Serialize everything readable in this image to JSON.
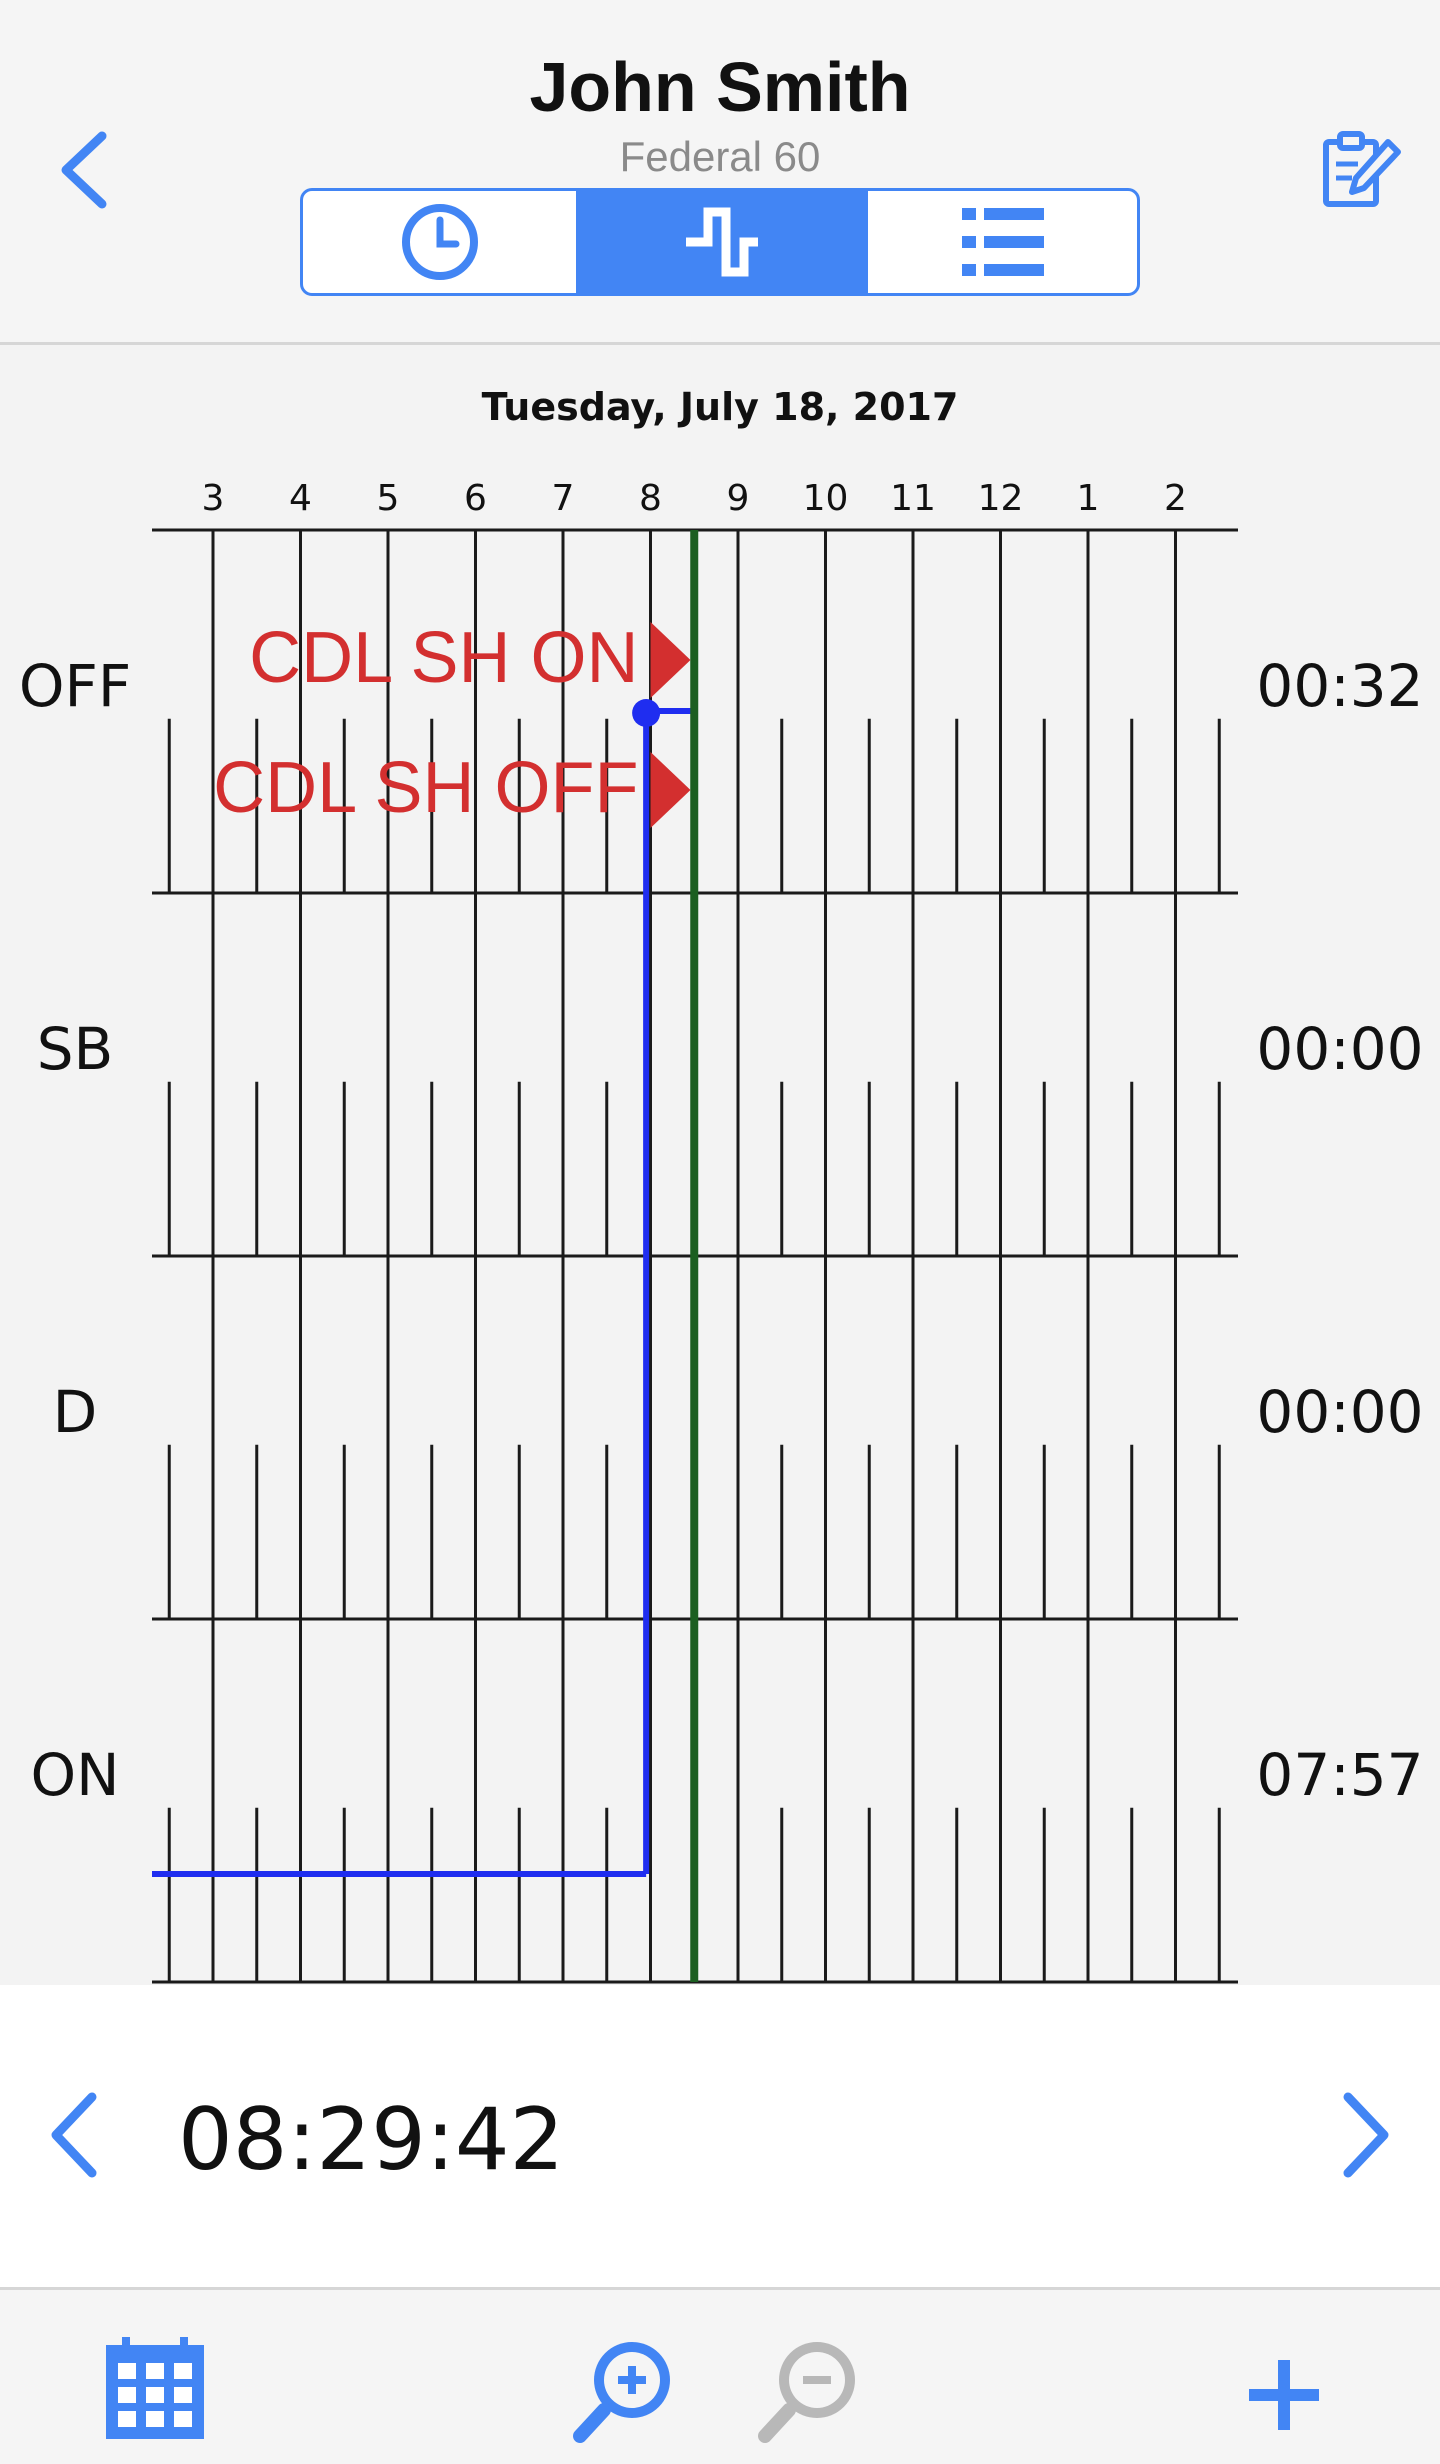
{
  "header": {
    "driver_name": "John Smith",
    "rule_set": "Federal 60",
    "tabs": [
      {
        "icon": "clock-icon",
        "selected": false
      },
      {
        "icon": "graph-icon",
        "selected": true
      },
      {
        "icon": "list-icon",
        "selected": false
      }
    ],
    "back_icon": "chevron-left-icon",
    "edit_icon": "edit-log-icon"
  },
  "graph": {
    "date": "Tuesday, July 18, 2017",
    "hour_labels": [
      "3",
      "4",
      "5",
      "6",
      "7",
      "8",
      "9",
      "10",
      "11",
      "12",
      "1",
      "2"
    ],
    "rows": [
      {
        "status": "OFF",
        "total": "00:32"
      },
      {
        "status": "SB",
        "total": "00:00"
      },
      {
        "status": "D",
        "total": "00:00"
      },
      {
        "status": "ON",
        "total": "07:57"
      }
    ],
    "events": [
      {
        "label": "CDL SH ON",
        "hour": 8.0
      },
      {
        "label": "CDL SH OFF",
        "hour": 8.0
      }
    ],
    "status_line": [
      {
        "status": "ON",
        "from": 2.0,
        "to": 7.95
      },
      {
        "status": "OFF",
        "from": 7.95,
        "to": 8.5
      }
    ],
    "current_time_hour": 8.5,
    "colors": {
      "status_line": "#1f2df0",
      "current_time": "#1b5e20",
      "event": "#d32f2f",
      "grid": "#1a1a1a"
    }
  },
  "time_nav": {
    "current_time": "08:29:42",
    "prev_icon": "chevron-left-icon",
    "next_icon": "chevron-right-icon"
  },
  "toolbar": {
    "items": [
      {
        "icon": "calendar-icon",
        "enabled": true
      },
      {
        "icon": "zoom-in-icon",
        "enabled": true
      },
      {
        "icon": "zoom-out-icon",
        "enabled": false
      },
      {
        "icon": "add-icon",
        "enabled": true
      }
    ]
  }
}
